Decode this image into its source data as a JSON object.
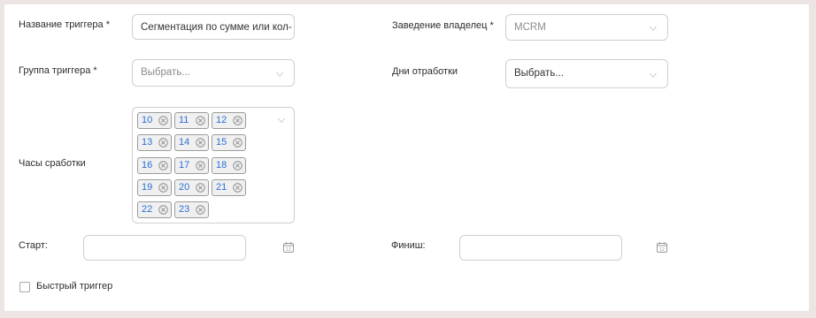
{
  "form": {
    "trigger_name": {
      "label": "Название триггера *",
      "value": "Сегментация по сумме или кол-в"
    },
    "owner_venue": {
      "label": "Заведение владелец *",
      "value": "MCRM"
    },
    "trigger_group": {
      "label": "Группа триггера *",
      "placeholder": "Выбрать..."
    },
    "work_days": {
      "label": "Дни отработки",
      "placeholder": "Выбрать..."
    },
    "work_hours": {
      "label": "Часы сработки",
      "chips": [
        "10",
        "11",
        "12",
        "13",
        "14",
        "15",
        "16",
        "17",
        "18",
        "19",
        "20",
        "21",
        "22",
        "23"
      ]
    },
    "start": {
      "label": "Старт:",
      "value": ""
    },
    "finish": {
      "label": "Финиш:",
      "value": ""
    },
    "fast_trigger": {
      "label": "Быстрый триггер",
      "checked": false
    }
  },
  "icons": {
    "dropdown": "chevron-down-icon",
    "chip_remove": "close-circle-icon",
    "calendar": "calendar-icon"
  },
  "colors": {
    "background": "#ece5e3",
    "chip_text": "#2a6fd6",
    "border": "#cfcfcf"
  }
}
